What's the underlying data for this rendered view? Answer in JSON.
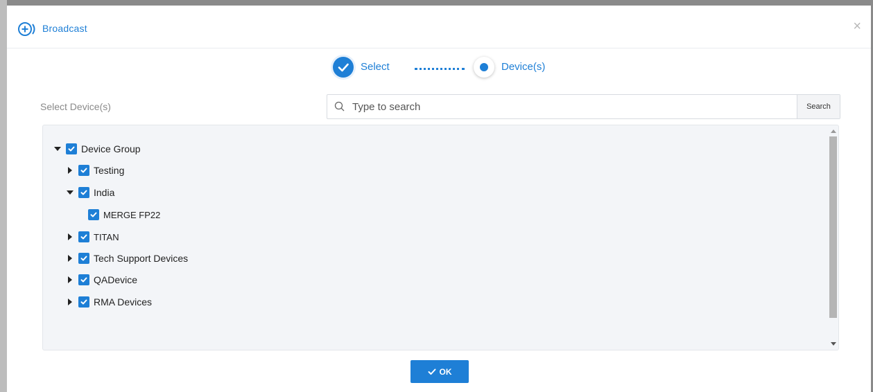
{
  "modal": {
    "title": "Broadcast",
    "close_symbol": "×"
  },
  "stepper": {
    "step1_label": "Select",
    "step2_label": "Device(s)"
  },
  "selector": {
    "label": "Select Device(s)",
    "search_placeholder": "Type to search",
    "search_button": "Search"
  },
  "tree": {
    "items": [
      {
        "label": "Device Group",
        "level": 0,
        "expanded": true,
        "checked": true
      },
      {
        "label": "Testing",
        "level": 1,
        "expanded": false,
        "checked": true
      },
      {
        "label": "India",
        "level": 1,
        "expanded": true,
        "checked": true
      },
      {
        "label": "MERGE FP22",
        "level": 2,
        "leaf": true,
        "checked": true
      },
      {
        "label": "TITAN",
        "level": 1,
        "expanded": false,
        "checked": true
      },
      {
        "label": "Tech Support Devices",
        "level": 1,
        "expanded": false,
        "checked": true
      },
      {
        "label": "QADevice",
        "level": 1,
        "expanded": false,
        "checked": true
      },
      {
        "label": "RMA Devices",
        "level": 1,
        "expanded": false,
        "checked": true
      }
    ]
  },
  "footer": {
    "ok_label": "OK"
  },
  "colors": {
    "accent": "#1e7fd6",
    "panel_bg": "#f3f5f8"
  },
  "icons": {
    "title": "broadcast-icon",
    "search": "search-icon",
    "check": "check-icon",
    "expand": "caret-icon"
  }
}
